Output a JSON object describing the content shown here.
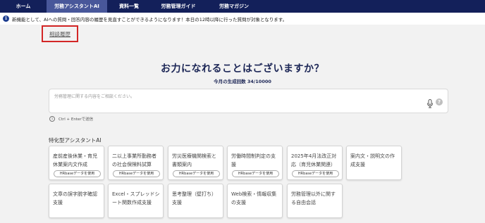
{
  "nav": {
    "items": [
      {
        "label": "ホーム"
      },
      {
        "label": "労務アシスタントAI"
      },
      {
        "label": "資料一覧"
      },
      {
        "label": "労務管理ガイド"
      },
      {
        "label": "労務マガジン"
      }
    ],
    "active": "労務アシスタントAI"
  },
  "notice": {
    "icon": "info-icon",
    "text": "新機能として、AIへの質問・回答内容の履歴を見直すことができるようになります！本日の12時以降に行った質問が対象となります。"
  },
  "history_link": "相談履歴",
  "main": {
    "heading": "お力になれることはございますか？",
    "generation_count": "今月の生成回数 34/10000"
  },
  "chat": {
    "placeholder": "労務管理に関する内容をご相談ください。",
    "mic_icon": "microphone-icon",
    "help_icon": "question-icon",
    "help_glyph": "?"
  },
  "hint": {
    "icon_glyph": "i",
    "text": "Ctrl + Enterで送信"
  },
  "section": {
    "title": "特化型アシスタントAI"
  },
  "assistants": [
    {
      "label": "産前産後休業・育児休業案内文作成",
      "badge": "HRbaseデータを使用"
    },
    {
      "label": "二以上事業所勤務者の社会保険料試算",
      "badge": "HRbaseデータを使用"
    },
    {
      "label": "労災医療機関検索と書類案内",
      "badge": "HRbaseデータを使用"
    },
    {
      "label": "労働時間制判定の支援",
      "badge": "HRbaseデータを使用"
    },
    {
      "label": "2025年4月法改正対応（育児休業関連）",
      "badge": "HRbaseデータを使用"
    },
    {
      "label": "案内文・説明文の作成支援",
      "badge": ""
    },
    {
      "label": "文章の誤字脱字確認支援",
      "badge": ""
    },
    {
      "label": "Excel・スプレッドシート関数作成支援",
      "badge": ""
    },
    {
      "label": "思考整理（壁打ち）支援",
      "badge": ""
    },
    {
      "label": "Web検索・情報収集の支援",
      "badge": ""
    },
    {
      "label": "労務管理以外に関する自由会話",
      "badge": ""
    }
  ],
  "colors": {
    "nav_bg": "#13205a",
    "nav_active": "#48579a",
    "heading": "#1c2656",
    "highlight_border": "#d32626"
  }
}
